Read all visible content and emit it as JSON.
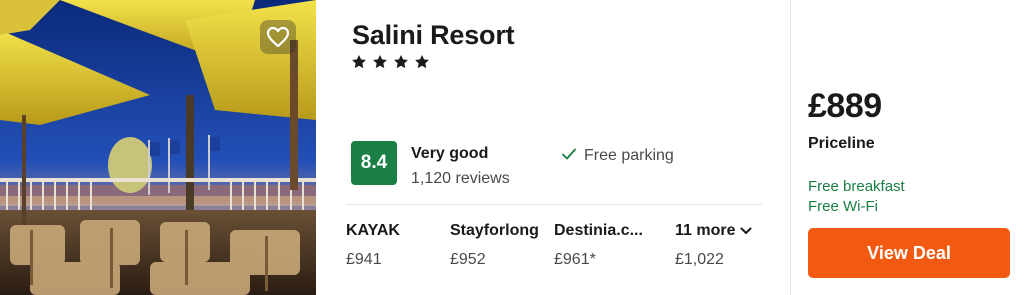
{
  "hotel": {
    "name": "Salini Resort",
    "stars": 4,
    "photo_alt_icon": "hotel-photo"
  },
  "favorite": {
    "icon": "heart-outline-icon"
  },
  "rating": {
    "score": "8.4",
    "word": "Very good",
    "reviews": "1,120 reviews",
    "color": "#1a7f45"
  },
  "amenities": [
    {
      "icon": "check-icon",
      "label": "Free parking"
    }
  ],
  "providers": [
    {
      "name": "KAYAK",
      "price": "£941"
    },
    {
      "name": "Stayforlong",
      "price": "£952"
    },
    {
      "name": "Destinia.c...",
      "price": "£961*"
    }
  ],
  "more": {
    "label": "11 more",
    "price": "£1,022",
    "icon": "chevron-down-icon"
  },
  "deal": {
    "price": "£889",
    "provider": "Priceline",
    "perks": [
      "Free breakfast",
      "Free Wi-Fi"
    ],
    "button_label": "View Deal",
    "button_color": "#f25a12",
    "perk_color": "#1a7f45"
  }
}
